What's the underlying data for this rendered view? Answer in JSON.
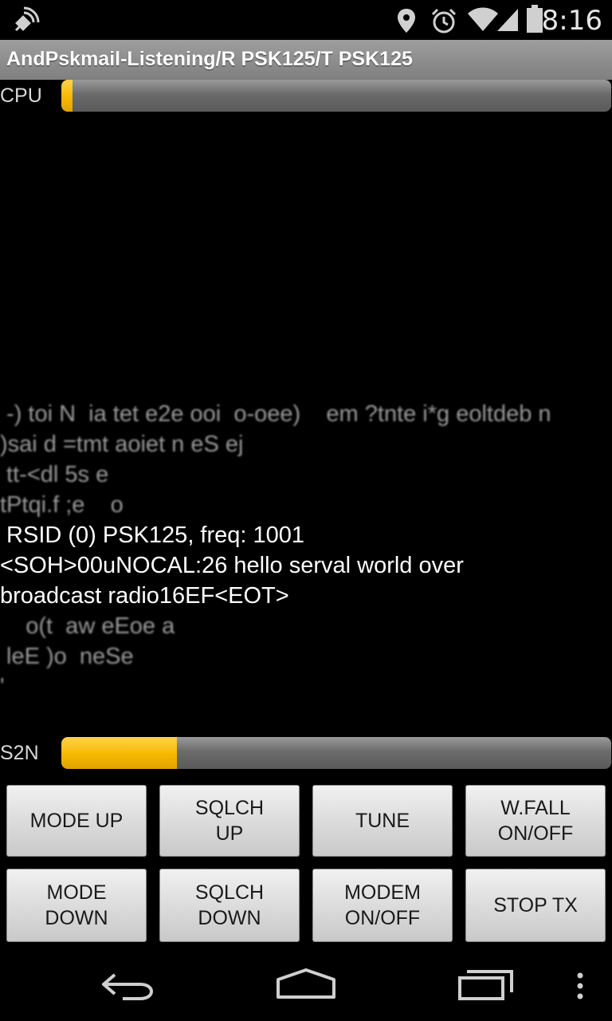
{
  "status_bar": {
    "time": "8:16",
    "icons": [
      "satellite-signal-icon",
      "location-pin-icon",
      "alarm-clock-icon",
      "wifi-icon",
      "cell-signal-icon",
      "battery-icon"
    ]
  },
  "app_bar": {
    "title": "AndPskmail-Listening/R PSK125/T PSK125"
  },
  "cpu_meter": {
    "label": "CPU",
    "level_percent": 2
  },
  "terminal": {
    "lines": [
      {
        "text": " -) toi N  ia tet e2e ooi  o-oee)    em ?tnte i*g eoltdeb n",
        "style": "blur"
      },
      {
        "text": ")sai d =tmt aoiet n eS ej",
        "style": "blur"
      },
      {
        "text": " tt-<dl 5s e",
        "style": "blur"
      },
      {
        "text": "tPtqi.f ;e    o",
        "style": "blur"
      },
      {
        "text": " RSID (0) PSK125, freq: 1001",
        "style": "sharp"
      },
      {
        "text": "",
        "style": "sharp"
      },
      {
        "text": "<SOH>00uNOCAL:26 hello serval world over",
        "style": "sharp"
      },
      {
        "text": "broadcast radio16EF<EOT>",
        "style": "sharp"
      },
      {
        "text": "    o(t  aw eEoe a",
        "style": "blur"
      },
      {
        "text": " leE )o  neSe",
        "style": "blur"
      },
      {
        "text": "'",
        "style": "blur"
      }
    ]
  },
  "s2n_meter": {
    "label": "S2N",
    "level_percent": 21
  },
  "buttons": {
    "mode_up": "MODE UP",
    "sqlch_up": "SQLCH\nUP",
    "tune": "TUNE",
    "wfall": "W.FALL\nON/OFF",
    "mode_down": "MODE\nDOWN",
    "sqlch_down": "SQLCH\nDOWN",
    "modem": "MODEM\nON/OFF",
    "stop_tx": "STOP TX"
  },
  "nav_bar": {
    "icons": [
      "back-icon",
      "home-icon",
      "recents-icon",
      "overflow-menu-icon"
    ]
  },
  "colors": {
    "meter_fill": "#f6b800",
    "meter_track": "#6b6b6b",
    "title_bar": "#8f8f8f"
  }
}
